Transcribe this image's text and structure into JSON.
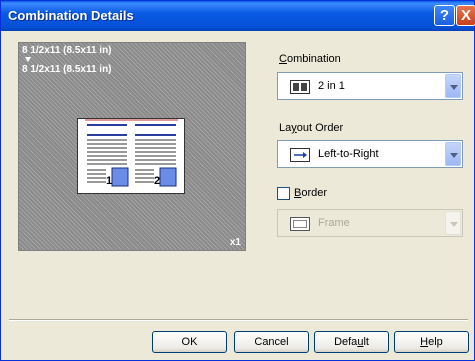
{
  "window": {
    "title": "Combination Details",
    "help_glyph": "?",
    "close_glyph": "X"
  },
  "preview": {
    "original_size": "8 1/2x11 (8.5x11 in)",
    "output_size": "8 1/2x11 (8.5x11 in)",
    "copies": "x1",
    "page_numbers": [
      "1",
      "2"
    ]
  },
  "combination": {
    "label_first": "C",
    "label_rest": "ombination",
    "value": "2 in 1",
    "icon": "two-pages-icon"
  },
  "layout_order": {
    "label_pre": "La",
    "label_ul": "y",
    "label_post": "out Order",
    "value": "Left-to-Right",
    "icon": "right-arrow-icon"
  },
  "border": {
    "label_first": "B",
    "label_rest": "order",
    "checked": false,
    "value": "Frame",
    "enabled": false
  },
  "buttons": {
    "ok": "OK",
    "cancel": "Cancel",
    "default_pre": "Defa",
    "default_ul": "u",
    "default_post": "lt",
    "help_ul": "H",
    "help_post": "elp"
  },
  "colors": {
    "titlebar": "#0a5ae4",
    "preview_bg": "#8a8a8a",
    "dialog_bg": "#ece9d8",
    "page_line": "#2a3ea0",
    "page_badge": "#6a8ee8"
  }
}
